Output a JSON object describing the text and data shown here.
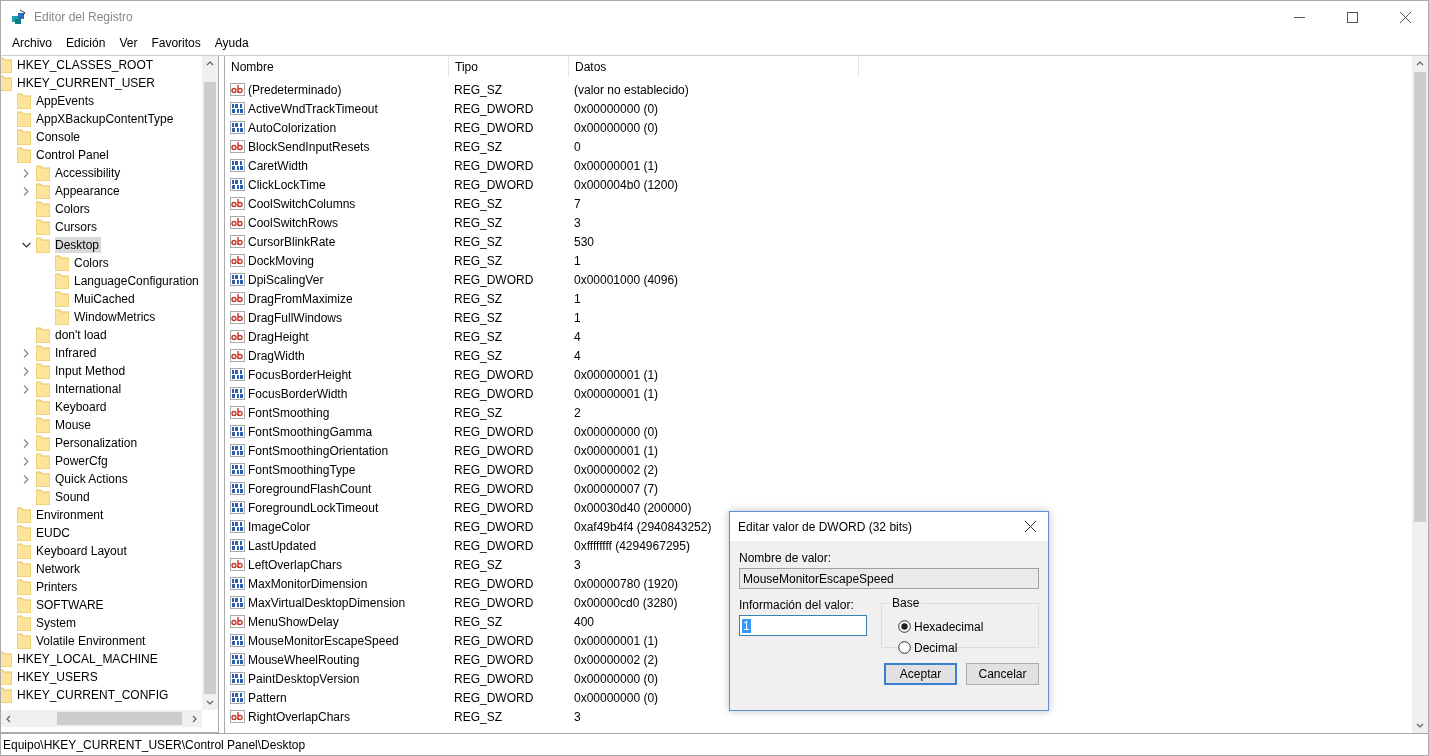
{
  "window": {
    "title": "Editor del Registro"
  },
  "menu": [
    "Archivo",
    "Edición",
    "Ver",
    "Favoritos",
    "Ayuda"
  ],
  "tree": [
    {
      "label": "HKEY_CLASSES_ROOT",
      "expandable": false,
      "selected": false
    },
    {
      "label": "HKEY_CURRENT_USER",
      "expandable": false,
      "selected": false,
      "children": [
        {
          "label": "AppEvents",
          "expandable": false,
          "selected": false
        },
        {
          "label": "AppXBackupContentType",
          "expandable": false,
          "selected": false
        },
        {
          "label": "Console",
          "expandable": false,
          "selected": false
        },
        {
          "label": "Control Panel",
          "expandable": false,
          "selected": false,
          "children": [
            {
              "label": "Accessibility",
              "expandable": true,
              "expanded": false,
              "selected": false
            },
            {
              "label": "Appearance",
              "expandable": true,
              "expanded": false,
              "selected": false
            },
            {
              "label": "Colors",
              "expandable": false,
              "selected": false
            },
            {
              "label": "Cursors",
              "expandable": false,
              "selected": false
            },
            {
              "label": "Desktop",
              "expandable": true,
              "expanded": true,
              "selected": true,
              "children": [
                {
                  "label": "Colors",
                  "expandable": false,
                  "selected": false
                },
                {
                  "label": "LanguageConfiguration",
                  "expandable": false,
                  "selected": false
                },
                {
                  "label": "MuiCached",
                  "expandable": false,
                  "selected": false
                },
                {
                  "label": "WindowMetrics",
                  "expandable": false,
                  "selected": false
                }
              ]
            },
            {
              "label": "don't load",
              "expandable": false,
              "selected": false
            },
            {
              "label": "Infrared",
              "expandable": true,
              "expanded": false,
              "selected": false
            },
            {
              "label": "Input Method",
              "expandable": true,
              "expanded": false,
              "selected": false
            },
            {
              "label": "International",
              "expandable": true,
              "expanded": false,
              "selected": false
            },
            {
              "label": "Keyboard",
              "expandable": false,
              "selected": false
            },
            {
              "label": "Mouse",
              "expandable": false,
              "selected": false
            },
            {
              "label": "Personalization",
              "expandable": true,
              "expanded": false,
              "selected": false
            },
            {
              "label": "PowerCfg",
              "expandable": true,
              "expanded": false,
              "selected": false
            },
            {
              "label": "Quick Actions",
              "expandable": true,
              "expanded": false,
              "selected": false
            },
            {
              "label": "Sound",
              "expandable": false,
              "selected": false
            }
          ]
        },
        {
          "label": "Environment",
          "expandable": false,
          "selected": false
        },
        {
          "label": "EUDC",
          "expandable": false,
          "selected": false
        },
        {
          "label": "Keyboard Layout",
          "expandable": false,
          "selected": false
        },
        {
          "label": "Network",
          "expandable": false,
          "selected": false
        },
        {
          "label": "Printers",
          "expandable": false,
          "selected": false
        },
        {
          "label": "SOFTWARE",
          "expandable": false,
          "selected": false
        },
        {
          "label": "System",
          "expandable": false,
          "selected": false
        },
        {
          "label": "Volatile Environment",
          "expandable": false,
          "selected": false
        }
      ]
    },
    {
      "label": "HKEY_LOCAL_MACHINE",
      "expandable": false,
      "selected": false
    },
    {
      "label": "HKEY_USERS",
      "expandable": false,
      "selected": false
    },
    {
      "label": "HKEY_CURRENT_CONFIG",
      "expandable": false,
      "selected": false
    }
  ],
  "table": {
    "columns": [
      "Nombre",
      "Tipo",
      "Datos"
    ],
    "rows": [
      {
        "kind": "sz",
        "name": "(Predeterminado)",
        "type": "REG_SZ",
        "data": "(valor no establecido)"
      },
      {
        "kind": "dword",
        "name": "ActiveWndTrackTimeout",
        "type": "REG_DWORD",
        "data": "0x00000000 (0)"
      },
      {
        "kind": "dword",
        "name": "AutoColorization",
        "type": "REG_DWORD",
        "data": "0x00000000 (0)"
      },
      {
        "kind": "sz",
        "name": "BlockSendInputResets",
        "type": "REG_SZ",
        "data": "0"
      },
      {
        "kind": "dword",
        "name": "CaretWidth",
        "type": "REG_DWORD",
        "data": "0x00000001 (1)"
      },
      {
        "kind": "dword",
        "name": "ClickLockTime",
        "type": "REG_DWORD",
        "data": "0x000004b0 (1200)"
      },
      {
        "kind": "sz",
        "name": "CoolSwitchColumns",
        "type": "REG_SZ",
        "data": "7"
      },
      {
        "kind": "sz",
        "name": "CoolSwitchRows",
        "type": "REG_SZ",
        "data": "3"
      },
      {
        "kind": "sz",
        "name": "CursorBlinkRate",
        "type": "REG_SZ",
        "data": "530"
      },
      {
        "kind": "sz",
        "name": "DockMoving",
        "type": "REG_SZ",
        "data": "1"
      },
      {
        "kind": "dword",
        "name": "DpiScalingVer",
        "type": "REG_DWORD",
        "data": "0x00001000 (4096)"
      },
      {
        "kind": "sz",
        "name": "DragFromMaximize",
        "type": "REG_SZ",
        "data": "1"
      },
      {
        "kind": "sz",
        "name": "DragFullWindows",
        "type": "REG_SZ",
        "data": "1"
      },
      {
        "kind": "sz",
        "name": "DragHeight",
        "type": "REG_SZ",
        "data": "4"
      },
      {
        "kind": "sz",
        "name": "DragWidth",
        "type": "REG_SZ",
        "data": "4"
      },
      {
        "kind": "dword",
        "name": "FocusBorderHeight",
        "type": "REG_DWORD",
        "data": "0x00000001 (1)"
      },
      {
        "kind": "dword",
        "name": "FocusBorderWidth",
        "type": "REG_DWORD",
        "data": "0x00000001 (1)"
      },
      {
        "kind": "sz",
        "name": "FontSmoothing",
        "type": "REG_SZ",
        "data": "2"
      },
      {
        "kind": "dword",
        "name": "FontSmoothingGamma",
        "type": "REG_DWORD",
        "data": "0x00000000 (0)"
      },
      {
        "kind": "dword",
        "name": "FontSmoothingOrientation",
        "type": "REG_DWORD",
        "data": "0x00000001 (1)"
      },
      {
        "kind": "dword",
        "name": "FontSmoothingType",
        "type": "REG_DWORD",
        "data": "0x00000002 (2)"
      },
      {
        "kind": "dword",
        "name": "ForegroundFlashCount",
        "type": "REG_DWORD",
        "data": "0x00000007 (7)"
      },
      {
        "kind": "dword",
        "name": "ForegroundLockTimeout",
        "type": "REG_DWORD",
        "data": "0x00030d40 (200000)"
      },
      {
        "kind": "dword",
        "name": "ImageColor",
        "type": "REG_DWORD",
        "data": "0xaf49b4f4 (2940843252)"
      },
      {
        "kind": "dword",
        "name": "LastUpdated",
        "type": "REG_DWORD",
        "data": "0xffffffff (4294967295)"
      },
      {
        "kind": "sz",
        "name": "LeftOverlapChars",
        "type": "REG_SZ",
        "data": "3"
      },
      {
        "kind": "dword",
        "name": "MaxMonitorDimension",
        "type": "REG_DWORD",
        "data": "0x00000780 (1920)"
      },
      {
        "kind": "dword",
        "name": "MaxVirtualDesktopDimension",
        "type": "REG_DWORD",
        "data": "0x00000cd0 (3280)"
      },
      {
        "kind": "sz",
        "name": "MenuShowDelay",
        "type": "REG_SZ",
        "data": "400"
      },
      {
        "kind": "dword",
        "name": "MouseMonitorEscapeSpeed",
        "type": "REG_DWORD",
        "data": "0x00000001 (1)"
      },
      {
        "kind": "dword",
        "name": "MouseWheelRouting",
        "type": "REG_DWORD",
        "data": "0x00000002 (2)"
      },
      {
        "kind": "dword",
        "name": "PaintDesktopVersion",
        "type": "REG_DWORD",
        "data": "0x00000000 (0)"
      },
      {
        "kind": "dword",
        "name": "Pattern",
        "type": "REG_DWORD",
        "data": "0x00000000 (0)"
      },
      {
        "kind": "sz",
        "name": "RightOverlapChars",
        "type": "REG_SZ",
        "data": "3"
      }
    ]
  },
  "dialog": {
    "title": "Editar valor de DWORD (32 bits)",
    "name_label": "Nombre de valor:",
    "name_value": "MouseMonitorEscapeSpeed",
    "data_label": "Información del valor:",
    "data_value": "1",
    "base_label": "Base",
    "bases": [
      {
        "label": "Hexadecimal",
        "selected": true
      },
      {
        "label": "Decimal",
        "selected": false
      }
    ],
    "buttons": [
      {
        "label": "Aceptar",
        "default": true
      },
      {
        "label": "Cancelar",
        "default": false
      }
    ]
  },
  "status_bar": "Equipo\\HKEY_CURRENT_USER\\Control Panel\\Desktop"
}
